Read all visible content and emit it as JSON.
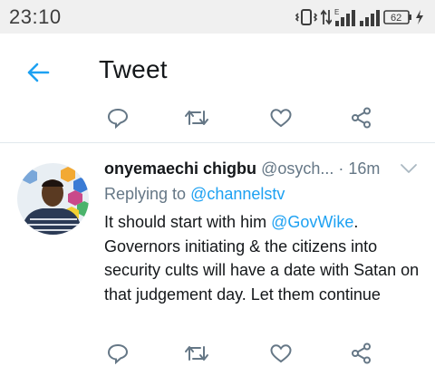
{
  "status_bar": {
    "time": "23:10",
    "battery_level": "62"
  },
  "header": {
    "title": "Tweet"
  },
  "tweet": {
    "author_name": "onyemaechi chigbu",
    "author_handle": "@osych...",
    "separator": " · ",
    "time": "16m",
    "replying_label": "Replying to ",
    "replying_to": "@channelstv",
    "body_intro": "It should start with him ",
    "body_mention": "@GovWike",
    "body_rest": ". Governors initiating & the citizens into security cults will have a date with Satan on that judgement day. Let them continue"
  },
  "colors": {
    "accent": "#1da1f2",
    "icon_gray": "#657786",
    "text": "#14171a"
  },
  "icons": [
    "back-arrow-icon",
    "reply-icon",
    "retweet-icon",
    "like-icon",
    "share-icon",
    "chevron-down-icon"
  ]
}
